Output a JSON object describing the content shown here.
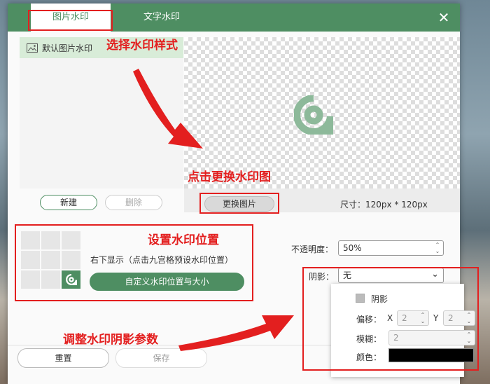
{
  "tabs": [
    "图片水印",
    "文字水印"
  ],
  "close_icon": "close-icon",
  "list": {
    "item_label": "默认图片水印",
    "item_icon": "image-icon"
  },
  "list_buttons": {
    "new": "新建",
    "delete": "删除"
  },
  "preview": {
    "change_image": "更换图片",
    "size_text": "尺寸：120px * 120px"
  },
  "position": {
    "text": "右下显示（点击九宫格预设水印位置）",
    "custom_button": "自定义水印位置与大小"
  },
  "opacity": {
    "label": "不透明度：",
    "value": "50%"
  },
  "shadow": {
    "label": "阴影：",
    "value": "无",
    "enable_label": "阴影",
    "offset_label": "偏移：",
    "x_label": "X",
    "x_value": "2",
    "y_label": "Y",
    "y_value": "2",
    "blur_label": "模糊：",
    "blur_value": "2",
    "color_label": "颜色：",
    "color_value": "#000000"
  },
  "footer": {
    "reset": "重置",
    "save": "保存"
  },
  "annotations": {
    "select_style": "选择水印样式",
    "change_image": "点击更换水印图",
    "set_position": "设置水印位置",
    "adjust_shadow": "调整水印阴影参数"
  },
  "colors": {
    "accent": "#4e8e62",
    "annotation": "#e31f1f"
  }
}
